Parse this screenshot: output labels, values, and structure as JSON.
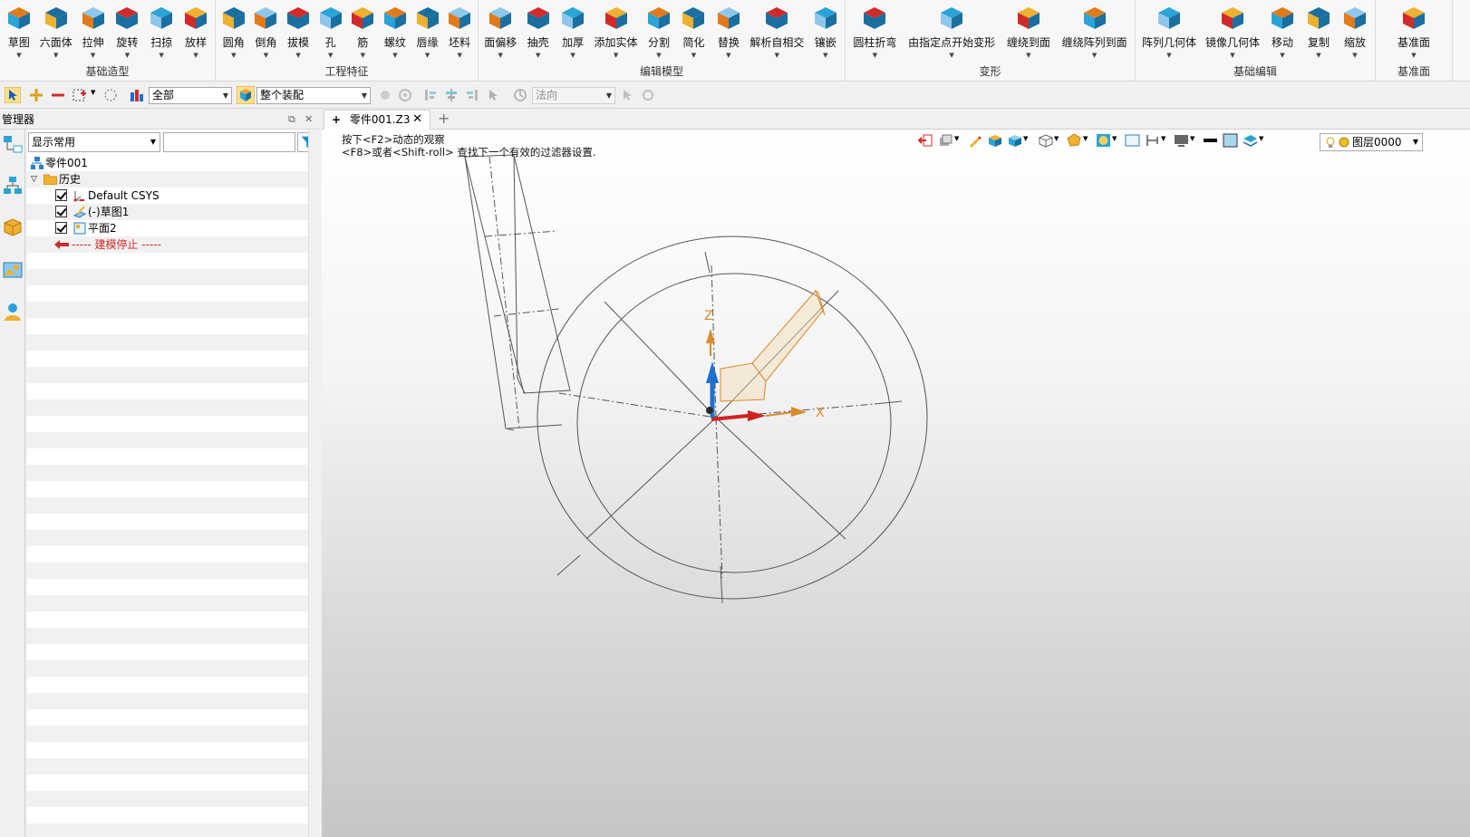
{
  "ribbon": {
    "groups": [
      {
        "name": "基础造型",
        "buttons": [
          "草图",
          "六面体",
          "拉伸",
          "旋转",
          "扫掠",
          "放样"
        ]
      },
      {
        "name": "工程特征",
        "buttons": [
          "圆角",
          "倒角",
          "拔模",
          "孔",
          "筋",
          "螺纹",
          "唇缘",
          "坯料"
        ]
      },
      {
        "name": "编辑模型",
        "buttons": [
          "面偏移",
          "抽壳",
          "加厚",
          "添加实体",
          "分割",
          "简化",
          "替换",
          "解析自相交",
          "镶嵌"
        ]
      },
      {
        "name": "变形",
        "buttons": [
          "圆柱折弯",
          "由指定点开始变形",
          "缠绕到面",
          "缠绕阵列到面"
        ]
      },
      {
        "name": "基础编辑",
        "buttons": [
          "阵列几何体",
          "镜像几何体",
          "移动",
          "复制",
          "缩放"
        ]
      },
      {
        "name": "基准面",
        "buttons": [
          "基准面"
        ]
      }
    ]
  },
  "toolbar2": {
    "filter_value": "全部",
    "assembly_value": "整个装配",
    "direction_value": "法向"
  },
  "manager": {
    "title": "管理器",
    "display_select": "显示常用",
    "search_value": "",
    "tree": {
      "root": "零件001",
      "history": "历史",
      "items": [
        "Default CSYS",
        "(-)草图1",
        "平面2"
      ],
      "stop": "----- 建模停止 -----"
    }
  },
  "tabs": {
    "active": "零件001.Z3"
  },
  "viewport": {
    "hint_line1": "按下<F2>动态的观察",
    "hint_line2": "<F8>或者<Shift-roll> 查找下一个有效的过滤器设置.",
    "layer": "图层0000",
    "axis_x": "X",
    "axis_z": "Z"
  },
  "colors": {
    "accent_orange": "#d98b2b",
    "axis_red": "#d42020",
    "axis_blue": "#1f6fd1",
    "icon_cyan": "#2aa3d6",
    "filter_blue": "#1a8fd0"
  }
}
